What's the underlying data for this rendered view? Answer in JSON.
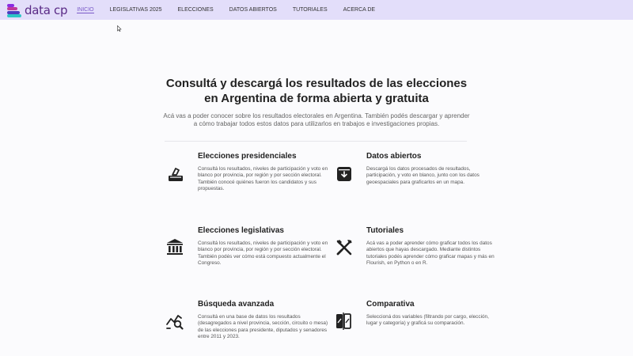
{
  "brand": {
    "name": "data cp"
  },
  "nav": {
    "links": [
      "INICIO",
      "LEGISLATIVAS 2025",
      "ELECCIONES",
      "DATOS ABIERTOS",
      "TUTORIALES",
      "ACERCA DE"
    ]
  },
  "hero": {
    "title_line1": "Consultá y descargá los resultados de las elecciones",
    "title_line2": "en Argentina de forma abierta y gratuita",
    "subtitle_line1": "Acá vas a poder conocer sobre los resultados electorales en Argentina. También podés descargar y aprender",
    "subtitle_line2": "a cómo trabajar todos estos datos para utilizarlos en trabajos e investigaciones propias."
  },
  "cards": [
    {
      "title": "Elecciones presidenciales",
      "icon": "ballot-box-icon",
      "desc": "Consultá los resultados, niveles de participación y voto en blanco por provincia, por región y por sección electoral. También conocé quiénes fueron los candidatos y sus propuestas."
    },
    {
      "title": "Datos abiertos",
      "icon": "archive-download-icon",
      "desc": "Descargá los datos procesados de resultados, participación, y voto en blanco, junto con los datos geoespaciales para graficarlos en un mapa."
    },
    {
      "title": "Elecciones legislativas",
      "icon": "congress-building-icon",
      "desc": "Consultá los resultados, niveles de participación y voto en blanco por provincia, por región y por sección electoral. También podés ver cómo está compuesto actualmente el Congreso."
    },
    {
      "title": "Tutoriales",
      "icon": "tools-icon",
      "desc": "Acá vas a poder aprender cómo graficar todos los datos abiertos que hayas descargado. Mediante distintos tutoriales podés aprender cómo graficar mapas y más en Flourish, en Python o en R."
    },
    {
      "title": "Búsqueda avanzada",
      "icon": "chart-search-icon",
      "desc": "Consultá en una base de datos los resultados (desagregados a nivel provincia, sección, circuito o mesa) de las elecciones para presidente, diputados y senadores entre 2011 y 2023."
    },
    {
      "title": "Comparativa",
      "icon": "compare-icon",
      "desc": "Seleccioná dos variables (filtrando por cargo, elección, lugar y categoría) y graficá su comparación."
    }
  ],
  "colors": {
    "navbar": "#e3defa",
    "brand_text": "#5a2a86",
    "active_link": "#7a5ac8",
    "logo_bar_1": "#8a2be2",
    "logo_bar_2": "#c0399a",
    "logo_bar_3": "#4b3fc1",
    "logo_bar_4": "#2cc6c6"
  }
}
